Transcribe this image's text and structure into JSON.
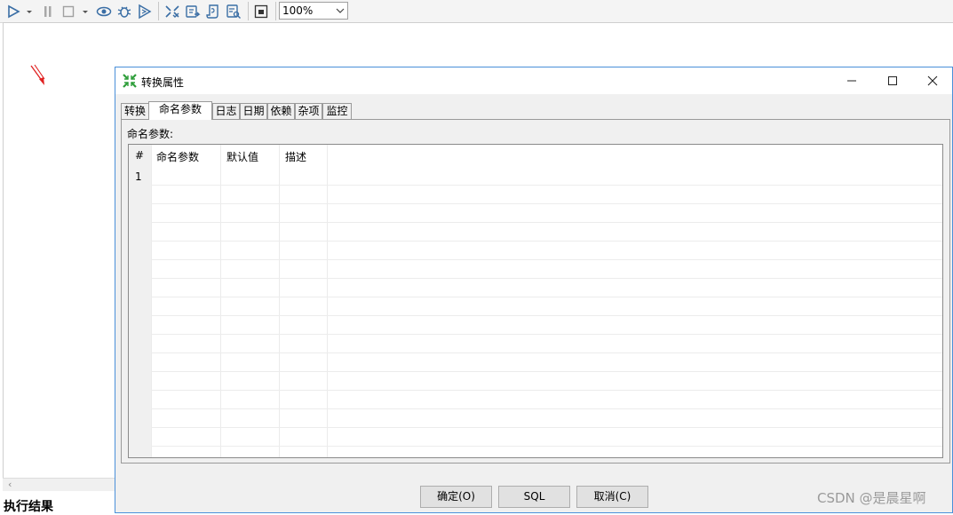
{
  "toolbar": {
    "buttons": [
      {
        "icon": "run-icon"
      },
      {
        "icon": "run-dropdown-icon"
      },
      {
        "icon": "pause-icon"
      },
      {
        "icon": "stop-icon"
      },
      {
        "icon": "stop-dropdown-icon"
      },
      {
        "icon": "preview-icon"
      },
      {
        "icon": "debug-icon"
      },
      {
        "icon": "replay-icon"
      },
      {
        "icon": "verify-icon"
      },
      {
        "icon": "impact-icon"
      },
      {
        "icon": "sql-icon"
      },
      {
        "icon": "explore-db-icon"
      },
      {
        "icon": "results-icon"
      }
    ],
    "zoom_value": "100%"
  },
  "canvas": {
    "result_label": "执行结果"
  },
  "dialog": {
    "title": "转换属性",
    "tabs": [
      {
        "label": "转换"
      },
      {
        "label": "命名参数"
      },
      {
        "label": "日志"
      },
      {
        "label": "日期"
      },
      {
        "label": "依赖"
      },
      {
        "label": "杂项"
      },
      {
        "label": "监控"
      }
    ],
    "active_tab": "命名参数",
    "panel_label": "命名参数:",
    "table": {
      "columns": [
        "#",
        "命名参数",
        "默认值",
        "描述"
      ],
      "rows": [
        [
          "1",
          "",
          "",
          ""
        ]
      ]
    },
    "buttons": {
      "ok": "确定(O)",
      "sql": "SQL",
      "cancel": "取消(C)"
    }
  },
  "watermark": "CSDN @是晨星啊",
  "colors": {
    "dialog_border": "#4a90d9",
    "title_icon": "#2e9e3a",
    "toolbar_icon": "#3a6ea5",
    "annotation_arrow": "#e02020"
  }
}
